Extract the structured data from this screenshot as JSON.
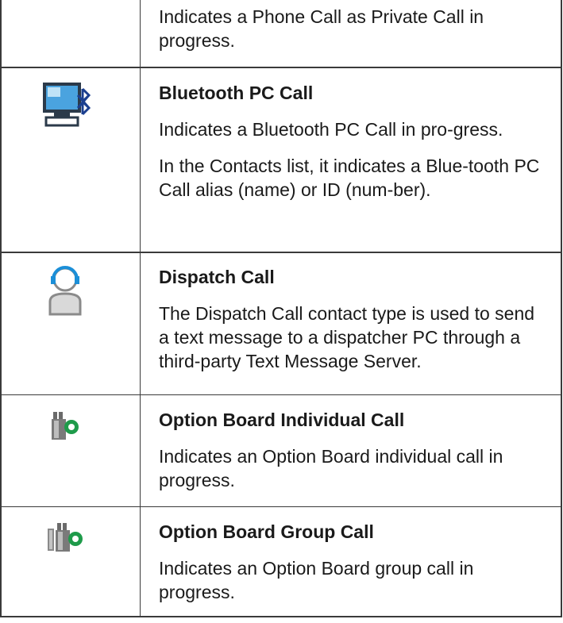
{
  "rows": [
    {
      "title": "",
      "paragraphs": [
        "Indicates a Phone Call as Private Call in progress."
      ]
    },
    {
      "title": "Bluetooth PC Call",
      "icon": "bluetooth-pc-call-icon",
      "paragraphs": [
        "Indicates a Bluetooth PC Call in pro-gress.",
        "In the Contacts list, it indicates a Blue-tooth PC Call alias (name) or ID (num-ber)."
      ]
    },
    {
      "title": "Dispatch Call",
      "icon": "dispatch-call-icon",
      "paragraphs": [
        "The Dispatch Call contact type is used to send a text message to a dispatcher PC through a third-party Text Message Server."
      ]
    },
    {
      "title": "Option Board Individual Call",
      "icon": "option-board-individual-call-icon",
      "paragraphs": [
        "Indicates an Option Board individual call in progress."
      ]
    },
    {
      "title": "Option Board Group Call",
      "icon": "option-board-group-call-icon",
      "paragraphs": [
        "Indicates an Option Board group call in progress."
      ]
    }
  ]
}
